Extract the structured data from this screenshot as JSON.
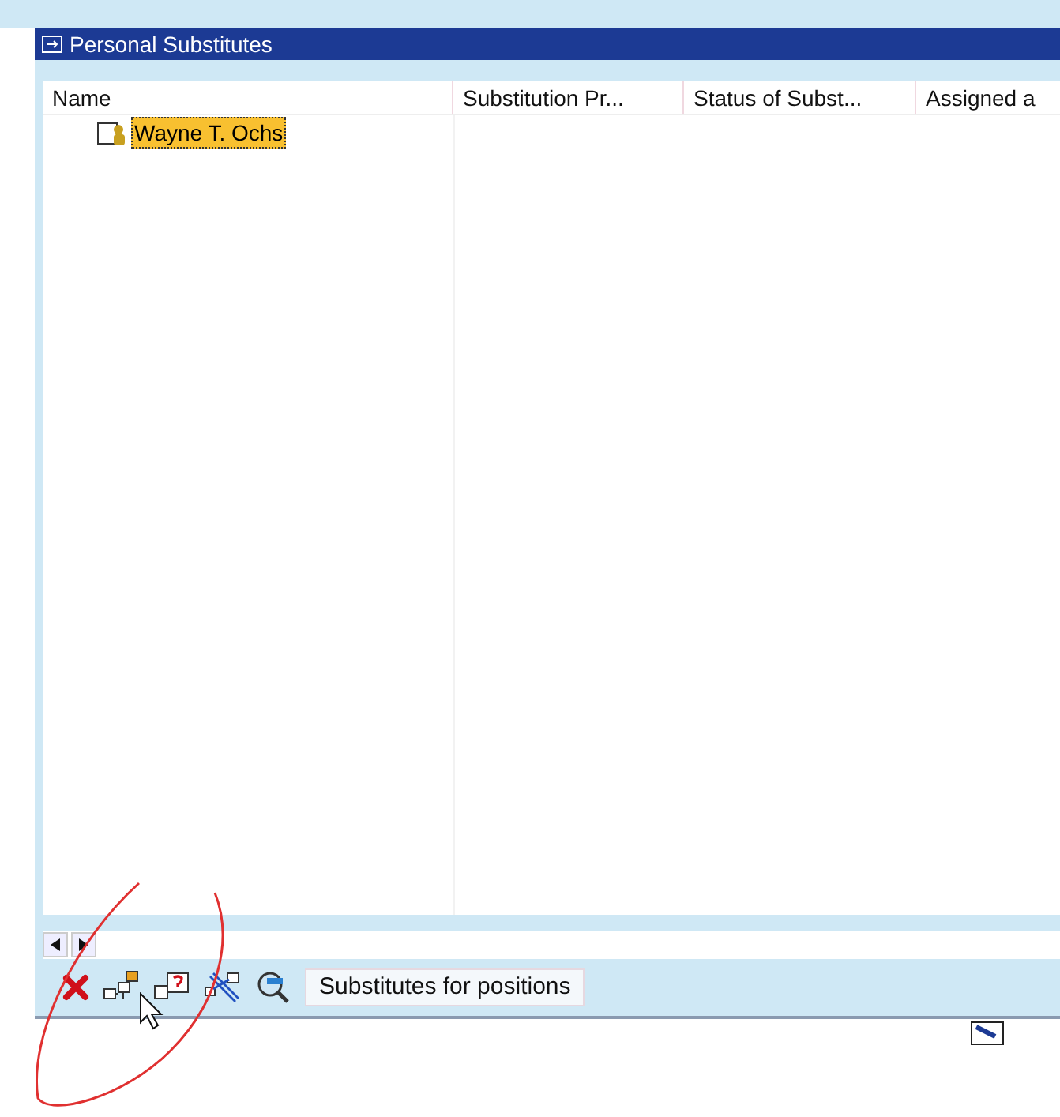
{
  "window": {
    "title": "Personal Substitutes"
  },
  "table": {
    "columns": [
      "Name",
      "Substitution Pr...",
      "Status of Subst...",
      "Assigned a"
    ],
    "rows": [
      {
        "name": "Wayne T. Ochs",
        "selected": true
      }
    ]
  },
  "toolbar": [
    {
      "kind": "delete"
    },
    {
      "kind": "hierarchy"
    },
    {
      "kind": "question"
    },
    {
      "kind": "unlink"
    },
    {
      "kind": "search"
    },
    {
      "kind": "text",
      "label": "Substitutes for positions"
    }
  ]
}
